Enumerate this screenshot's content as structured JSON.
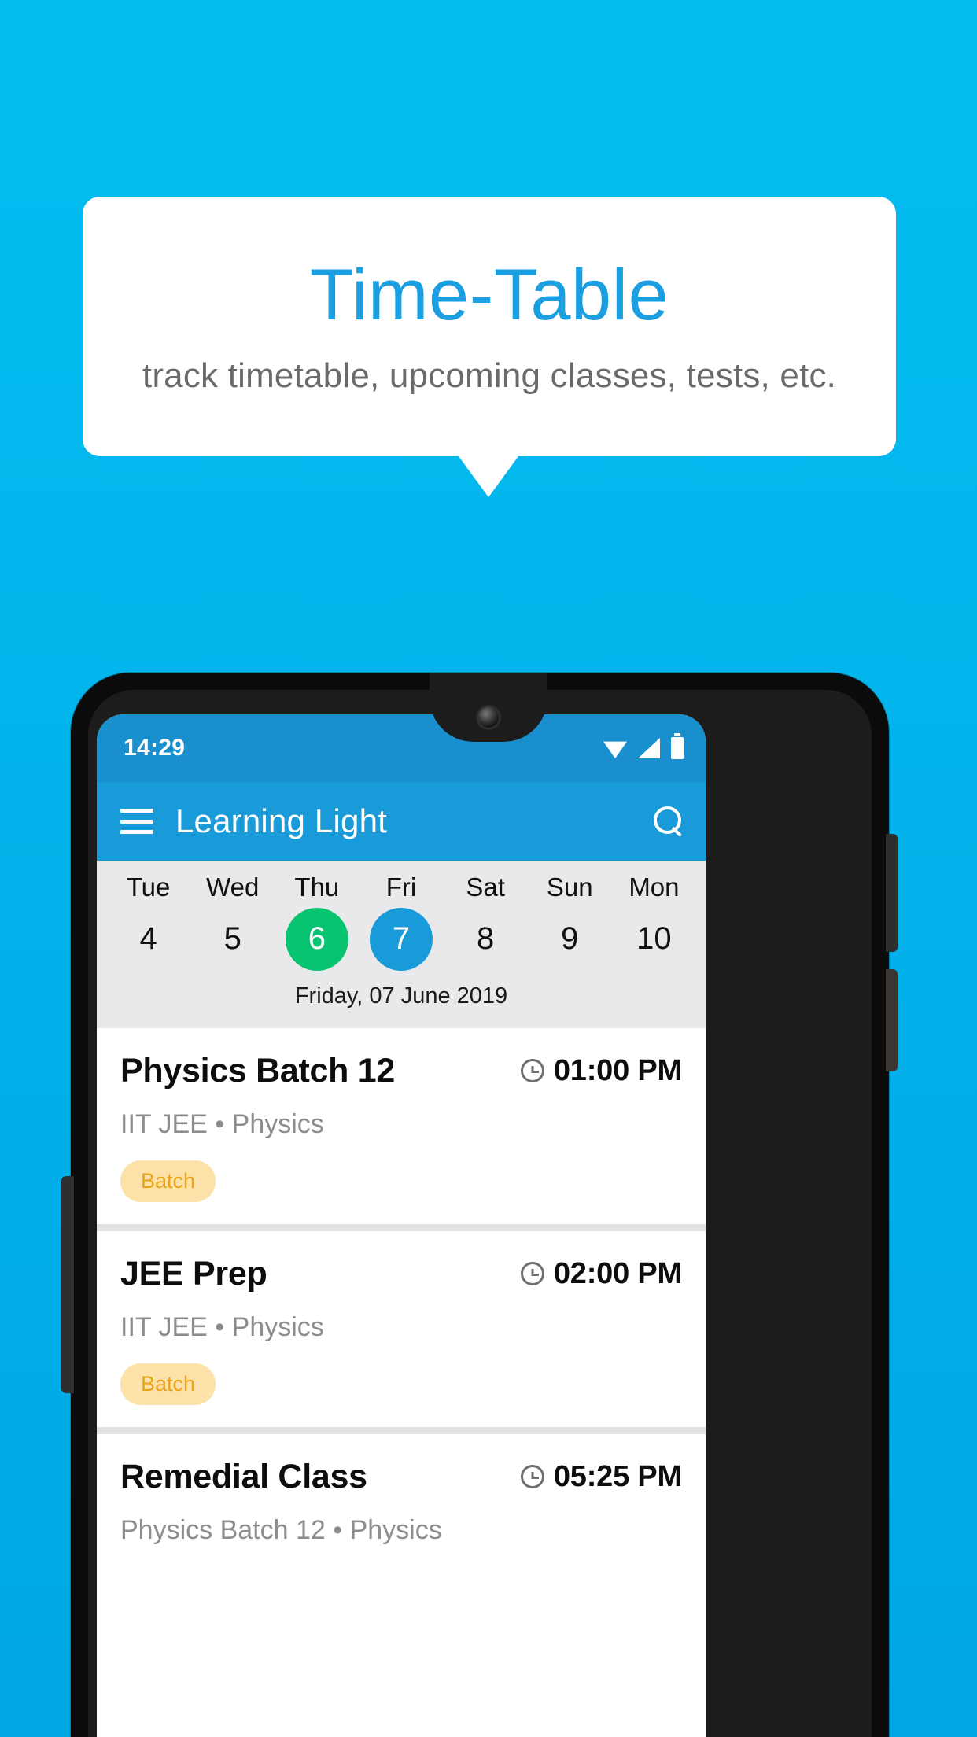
{
  "promo": {
    "title": "Time-Table",
    "subtitle": "track timetable, upcoming classes, tests, etc.",
    "accent_color": "#1b9fe0",
    "background_color": "#03bdf0"
  },
  "phone": {
    "status_bar": {
      "time": "14:29",
      "icons": [
        "wifi-icon",
        "signal-icon",
        "battery-icon"
      ],
      "background_color": "#1a8fce"
    },
    "app_bar": {
      "menu_icon": "hamburger-menu-icon",
      "title": "Learning Light",
      "search_icon": "search-icon",
      "background_color": "#1a9bd9"
    },
    "date_strip": {
      "background_color": "#e9e9eb",
      "days": [
        {
          "dow": "Tue",
          "num": "4",
          "state": "normal"
        },
        {
          "dow": "Wed",
          "num": "5",
          "state": "normal"
        },
        {
          "dow": "Thu",
          "num": "6",
          "state": "today"
        },
        {
          "dow": "Fri",
          "num": "7",
          "state": "selected"
        },
        {
          "dow": "Sat",
          "num": "8",
          "state": "normal"
        },
        {
          "dow": "Sun",
          "num": "9",
          "state": "normal"
        },
        {
          "dow": "Mon",
          "num": "10",
          "state": "normal"
        }
      ],
      "today_color": "#08c470",
      "selected_color": "#1a9bd9",
      "full_date": "Friday, 07 June 2019"
    },
    "classes": [
      {
        "name": "Physics Batch 12",
        "time": "01:00 PM",
        "time_icon": "clock-icon",
        "subtitle": "IIT JEE • Physics",
        "badge": "Batch"
      },
      {
        "name": "JEE Prep",
        "time": "02:00 PM",
        "time_icon": "clock-icon",
        "subtitle": "IIT JEE • Physics",
        "badge": "Batch"
      },
      {
        "name": "Remedial Class",
        "time": "05:25 PM",
        "time_icon": "clock-icon",
        "subtitle": "Physics Batch 12 • Physics",
        "badge": ""
      }
    ],
    "badge_bg_color": "#fce2a8",
    "badge_text_color": "#e8a317"
  }
}
